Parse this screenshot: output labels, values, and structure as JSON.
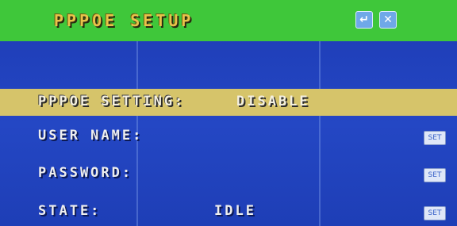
{
  "title": "PPPOE SETUP",
  "title_icons": [
    "confirm-icon",
    "close-icon"
  ],
  "rows": [
    {
      "label": "PPPOE SETTING:",
      "value": "DISABLE",
      "button": ""
    },
    {
      "label": "USER NAME:",
      "value": "",
      "button": "SET"
    },
    {
      "label": "PASSWORD:",
      "value": "",
      "button": "SET"
    },
    {
      "label": "STATE:",
      "value": "IDLE",
      "button": "SET"
    }
  ],
  "colors": {
    "title_bar": "#3fc73a",
    "background": "#1f3fb8",
    "highlight": "#d6c46a",
    "title_text": "#e8c24a"
  }
}
